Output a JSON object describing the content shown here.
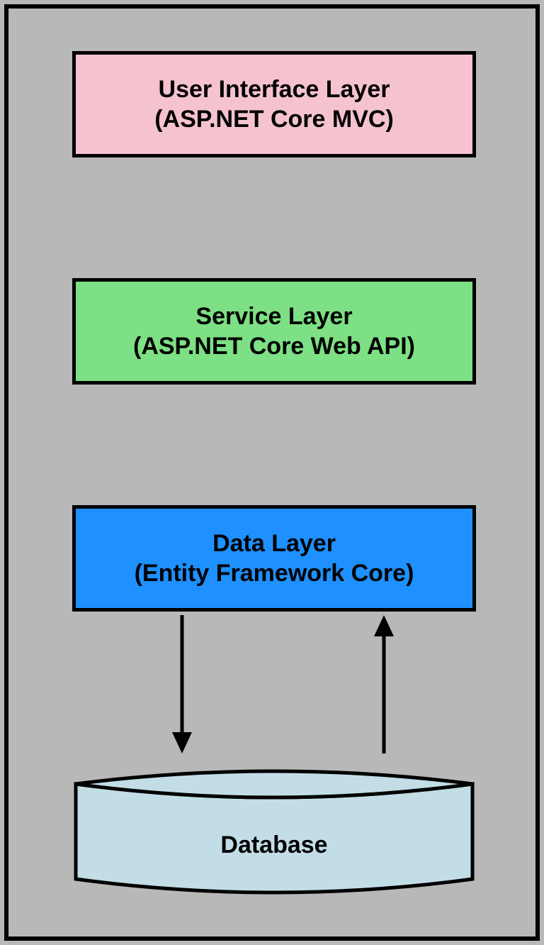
{
  "layers": {
    "ui": {
      "title": "User Interface Layer",
      "subtitle": "(ASP.NET Core MVC)"
    },
    "service": {
      "title": "Service Layer",
      "subtitle": "(ASP.NET Core Web API)"
    },
    "data": {
      "title": "Data Layer",
      "subtitle": "(Entity Framework Core)"
    },
    "database": {
      "title": "Database"
    }
  },
  "colors": {
    "ui_bg": "#f5c3d0",
    "service_bg": "#7de084",
    "data_bg": "#1e90ff",
    "database_bg": "#c2dde6",
    "border": "#000000",
    "background": "#b8b8b8"
  }
}
